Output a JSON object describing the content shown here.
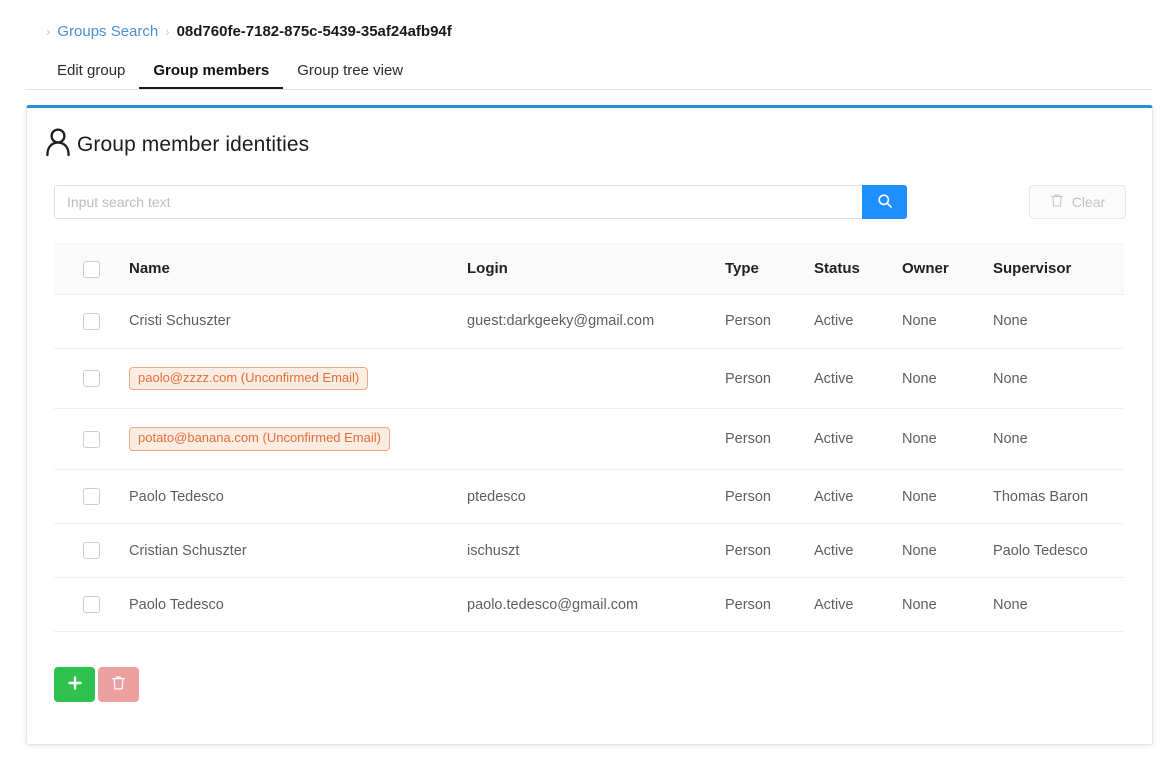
{
  "breadcrumb": {
    "separator": "›",
    "link_label": "Groups Search",
    "current": "08d760fe-7182-875c-5439-35af24afb94f"
  },
  "tabs": [
    {
      "label": "Edit group",
      "active": false
    },
    {
      "label": "Group members",
      "active": true
    },
    {
      "label": "Group tree view",
      "active": false
    }
  ],
  "card": {
    "icon": "person-icon",
    "title": "Group member identities"
  },
  "search": {
    "value": "",
    "placeholder": "Input search text",
    "search_icon": "search-icon",
    "clear_label": "Clear",
    "clear_icon": "trash-icon",
    "clear_disabled": true
  },
  "table": {
    "columns": [
      "Name",
      "Login",
      "Type",
      "Status",
      "Owner",
      "Supervisor"
    ],
    "select_all_checked": false,
    "rows": [
      {
        "checked": false,
        "name": "Cristi Schuszter",
        "name_is_badge": false,
        "login": "guest:darkgeeky@gmail.com",
        "type": "Person",
        "status": "Active",
        "owner": "None",
        "supervisor": "None"
      },
      {
        "checked": false,
        "name": "paolo@zzzz.com (Unconfirmed Email)",
        "name_is_badge": true,
        "login": "",
        "type": "Person",
        "status": "Active",
        "owner": "None",
        "supervisor": "None"
      },
      {
        "checked": false,
        "name": "potato@banana.com (Unconfirmed Email)",
        "name_is_badge": true,
        "login": "",
        "type": "Person",
        "status": "Active",
        "owner": "None",
        "supervisor": "None"
      },
      {
        "checked": false,
        "name": "Paolo Tedesco",
        "name_is_badge": false,
        "login": "ptedesco",
        "type": "Person",
        "status": "Active",
        "owner": "None",
        "supervisor": "Thomas Baron"
      },
      {
        "checked": false,
        "name": "Cristian Schuszter",
        "name_is_badge": false,
        "login": "ischuszt",
        "type": "Person",
        "status": "Active",
        "owner": "None",
        "supervisor": "Paolo Tedesco"
      },
      {
        "checked": false,
        "name": "Paolo Tedesco",
        "name_is_badge": false,
        "login": "paolo.tedesco@gmail.com",
        "type": "Person",
        "status": "Active",
        "owner": "None",
        "supervisor": "None"
      }
    ]
  },
  "footer": {
    "add_label": "+",
    "add_icon": "plus-icon",
    "delete_icon": "trash-icon"
  },
  "colors": {
    "card_top_border": "#2a8fd4",
    "link": "#4a90d9",
    "search_button": "#1e8fff",
    "badge_text": "#e2703a",
    "badge_bg": "#fdece2",
    "badge_border": "#f0a882",
    "add_button": "#2ec14e",
    "delete_button": "#eda0a0"
  }
}
